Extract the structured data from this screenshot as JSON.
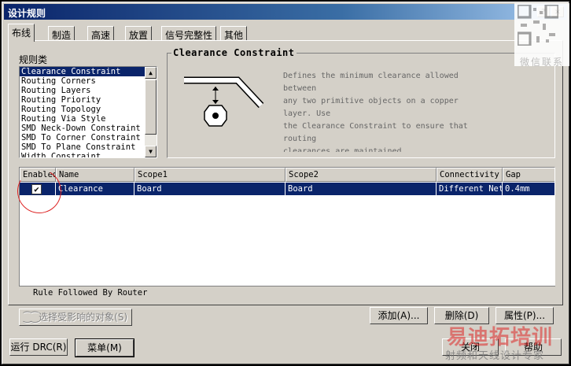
{
  "window": {
    "title": "设计规则",
    "help_glyph": "?",
    "close_glyph": "×"
  },
  "tabs": [
    "布线",
    "制造",
    "高速",
    "放置",
    "信号完整性",
    "其他"
  ],
  "rule_classes": {
    "label": "规则类",
    "items": [
      "Clearance Constraint",
      "Routing Corners",
      "Routing Layers",
      "Routing Priority",
      "Routing Topology",
      "Routing Via Style",
      "SMD Neck-Down Constraint",
      "SMD To Corner Constraint",
      "SMD To Plane Constraint",
      "Width Constraint"
    ],
    "selected_index": 0,
    "scroll_up_glyph": "▲",
    "scroll_down_glyph": "▼"
  },
  "description": {
    "title": "Clearance Constraint",
    "lines": [
      "Defines the minimum clearance allowed",
      "between",
      "any two primitive objects on a copper",
      "layer. Use",
      "the Clearance Constraint to ensure that",
      "routing",
      "clearances are maintained"
    ]
  },
  "rules_table": {
    "columns": [
      "Enabled",
      "Name",
      "Scope1",
      "Scope2",
      "Connectivity",
      "Gap"
    ],
    "rows": [
      {
        "enabled": true,
        "name": "Clearance",
        "scope1": "Board",
        "scope2": "Board",
        "connectivity": "Different Nets",
        "gap": "0.4mm"
      }
    ],
    "check_glyph": "✔",
    "status": "Rule Followed By Router"
  },
  "buttons": {
    "select_objects": "⁐⁐选择受影响的对象(S)",
    "add": "添加(A)...",
    "delete": "删除(D)",
    "properties": "属性(P)...",
    "run_drc": "运行 DRC(R)",
    "menu": "菜单(M)",
    "close": "关闭",
    "help": "帮助"
  },
  "overlay": {
    "qr_caption": "微信联系",
    "watermark_cn": "易迪拓培训",
    "watermark_sub": "射频和天线设计专家"
  },
  "colors": {
    "selection": "#0a246a",
    "face": "#d4d0c8",
    "annotation": "#dd2222"
  }
}
